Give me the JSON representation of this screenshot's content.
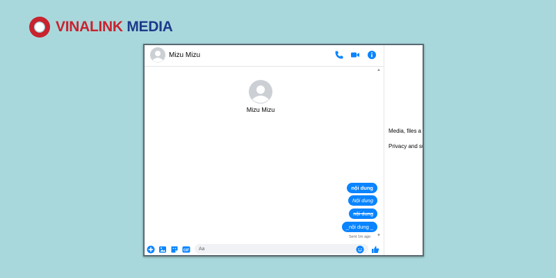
{
  "brand": {
    "part1": "VINALINK",
    "part2": "MEDIA"
  },
  "chat": {
    "contact_name": "Mizu Mizu",
    "profile_name": "Mizu Mizu",
    "messages": [
      {
        "text": "nội dung",
        "style": "bold"
      },
      {
        "text": "Nội dung",
        "style": "italic"
      },
      {
        "text": "nội dung",
        "style": "strikethrough"
      },
      {
        "text": "_nội dung _",
        "style": "plain"
      }
    ],
    "status": "Sent 1m ago",
    "composer": {
      "placeholder": "Aa"
    }
  },
  "right_panel": {
    "truncated_label": "P",
    "item_media": "Media, files a",
    "item_privacy": "Privacy and su"
  },
  "colors": {
    "accent": "#0a84ff",
    "background": "#a8d8dc",
    "brand_red": "#c8232f",
    "brand_navy": "#1d3a8a"
  },
  "icons": [
    "phone-icon",
    "video-icon",
    "info-icon",
    "plus-icon",
    "image-icon",
    "sticker-icon",
    "gif-icon",
    "emoji-icon",
    "thumbs-up-icon"
  ]
}
